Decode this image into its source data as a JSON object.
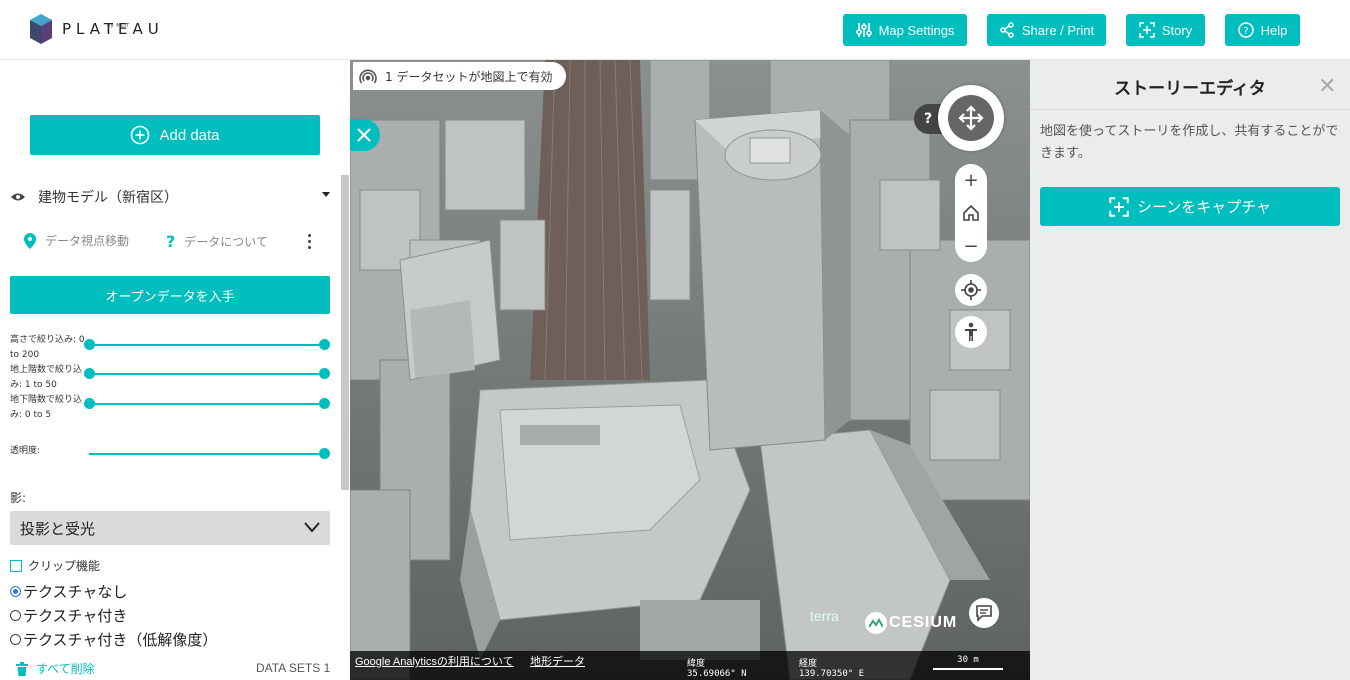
{
  "header": {
    "logo_text": "PLATEAU",
    "logo_sub": "by MLIT",
    "buttons": {
      "map_settings": "Map Settings",
      "share_print": "Share / Print",
      "story": "Story",
      "help": "Help"
    }
  },
  "left_panel": {
    "add_data": "Add data",
    "layer": {
      "name": "建物モデル（新宿区）",
      "fly_to": "データ視点移動",
      "about": "データについて",
      "open_data": "オープンデータを入手",
      "sliders": [
        {
          "label": "高さで絞り込み: 0 to 200",
          "min": 0,
          "max": 200
        },
        {
          "label": "地上階数で絞り込み: 1 to 50",
          "min": 1,
          "max": 50
        },
        {
          "label": "地下階数で絞り込み: 0 to 5",
          "min": 0,
          "max": 5
        }
      ],
      "opacity_label": "透明度:",
      "opacity_value": 1.0,
      "shadow_label": "影:",
      "shadow_value": "投影と受光",
      "clip_label": "クリップ機能",
      "texture_options": [
        "テクスチャなし",
        "テクスチャ付き",
        "テクスチャ付き（低解像度）"
      ],
      "texture_selected": 0
    },
    "footer": {
      "delete_all": "すべて削除",
      "datasets": "DATA SETS 1"
    }
  },
  "map": {
    "notice": "1 データセットが地図上で有効",
    "help": "?",
    "credits": {
      "terra": "terra",
      "cesium": "CESIUM"
    },
    "footer": {
      "analytics_link": "Google Analyticsの利用について",
      "terrain_link": "地形データ",
      "lat_label": "緯度",
      "lat_value": "35.69066° N",
      "lon_label": "経度",
      "lon_value": "139.70350° E",
      "scale": "30 m"
    }
  },
  "story_editor": {
    "title": "ストーリーエディタ",
    "description": "地図を使ってストーリを作成し、共有することができます。",
    "capture_button": "シーンをキャプチャ"
  },
  "colors": {
    "accent": "#00bebe",
    "radio_selected": "#2577e3"
  }
}
